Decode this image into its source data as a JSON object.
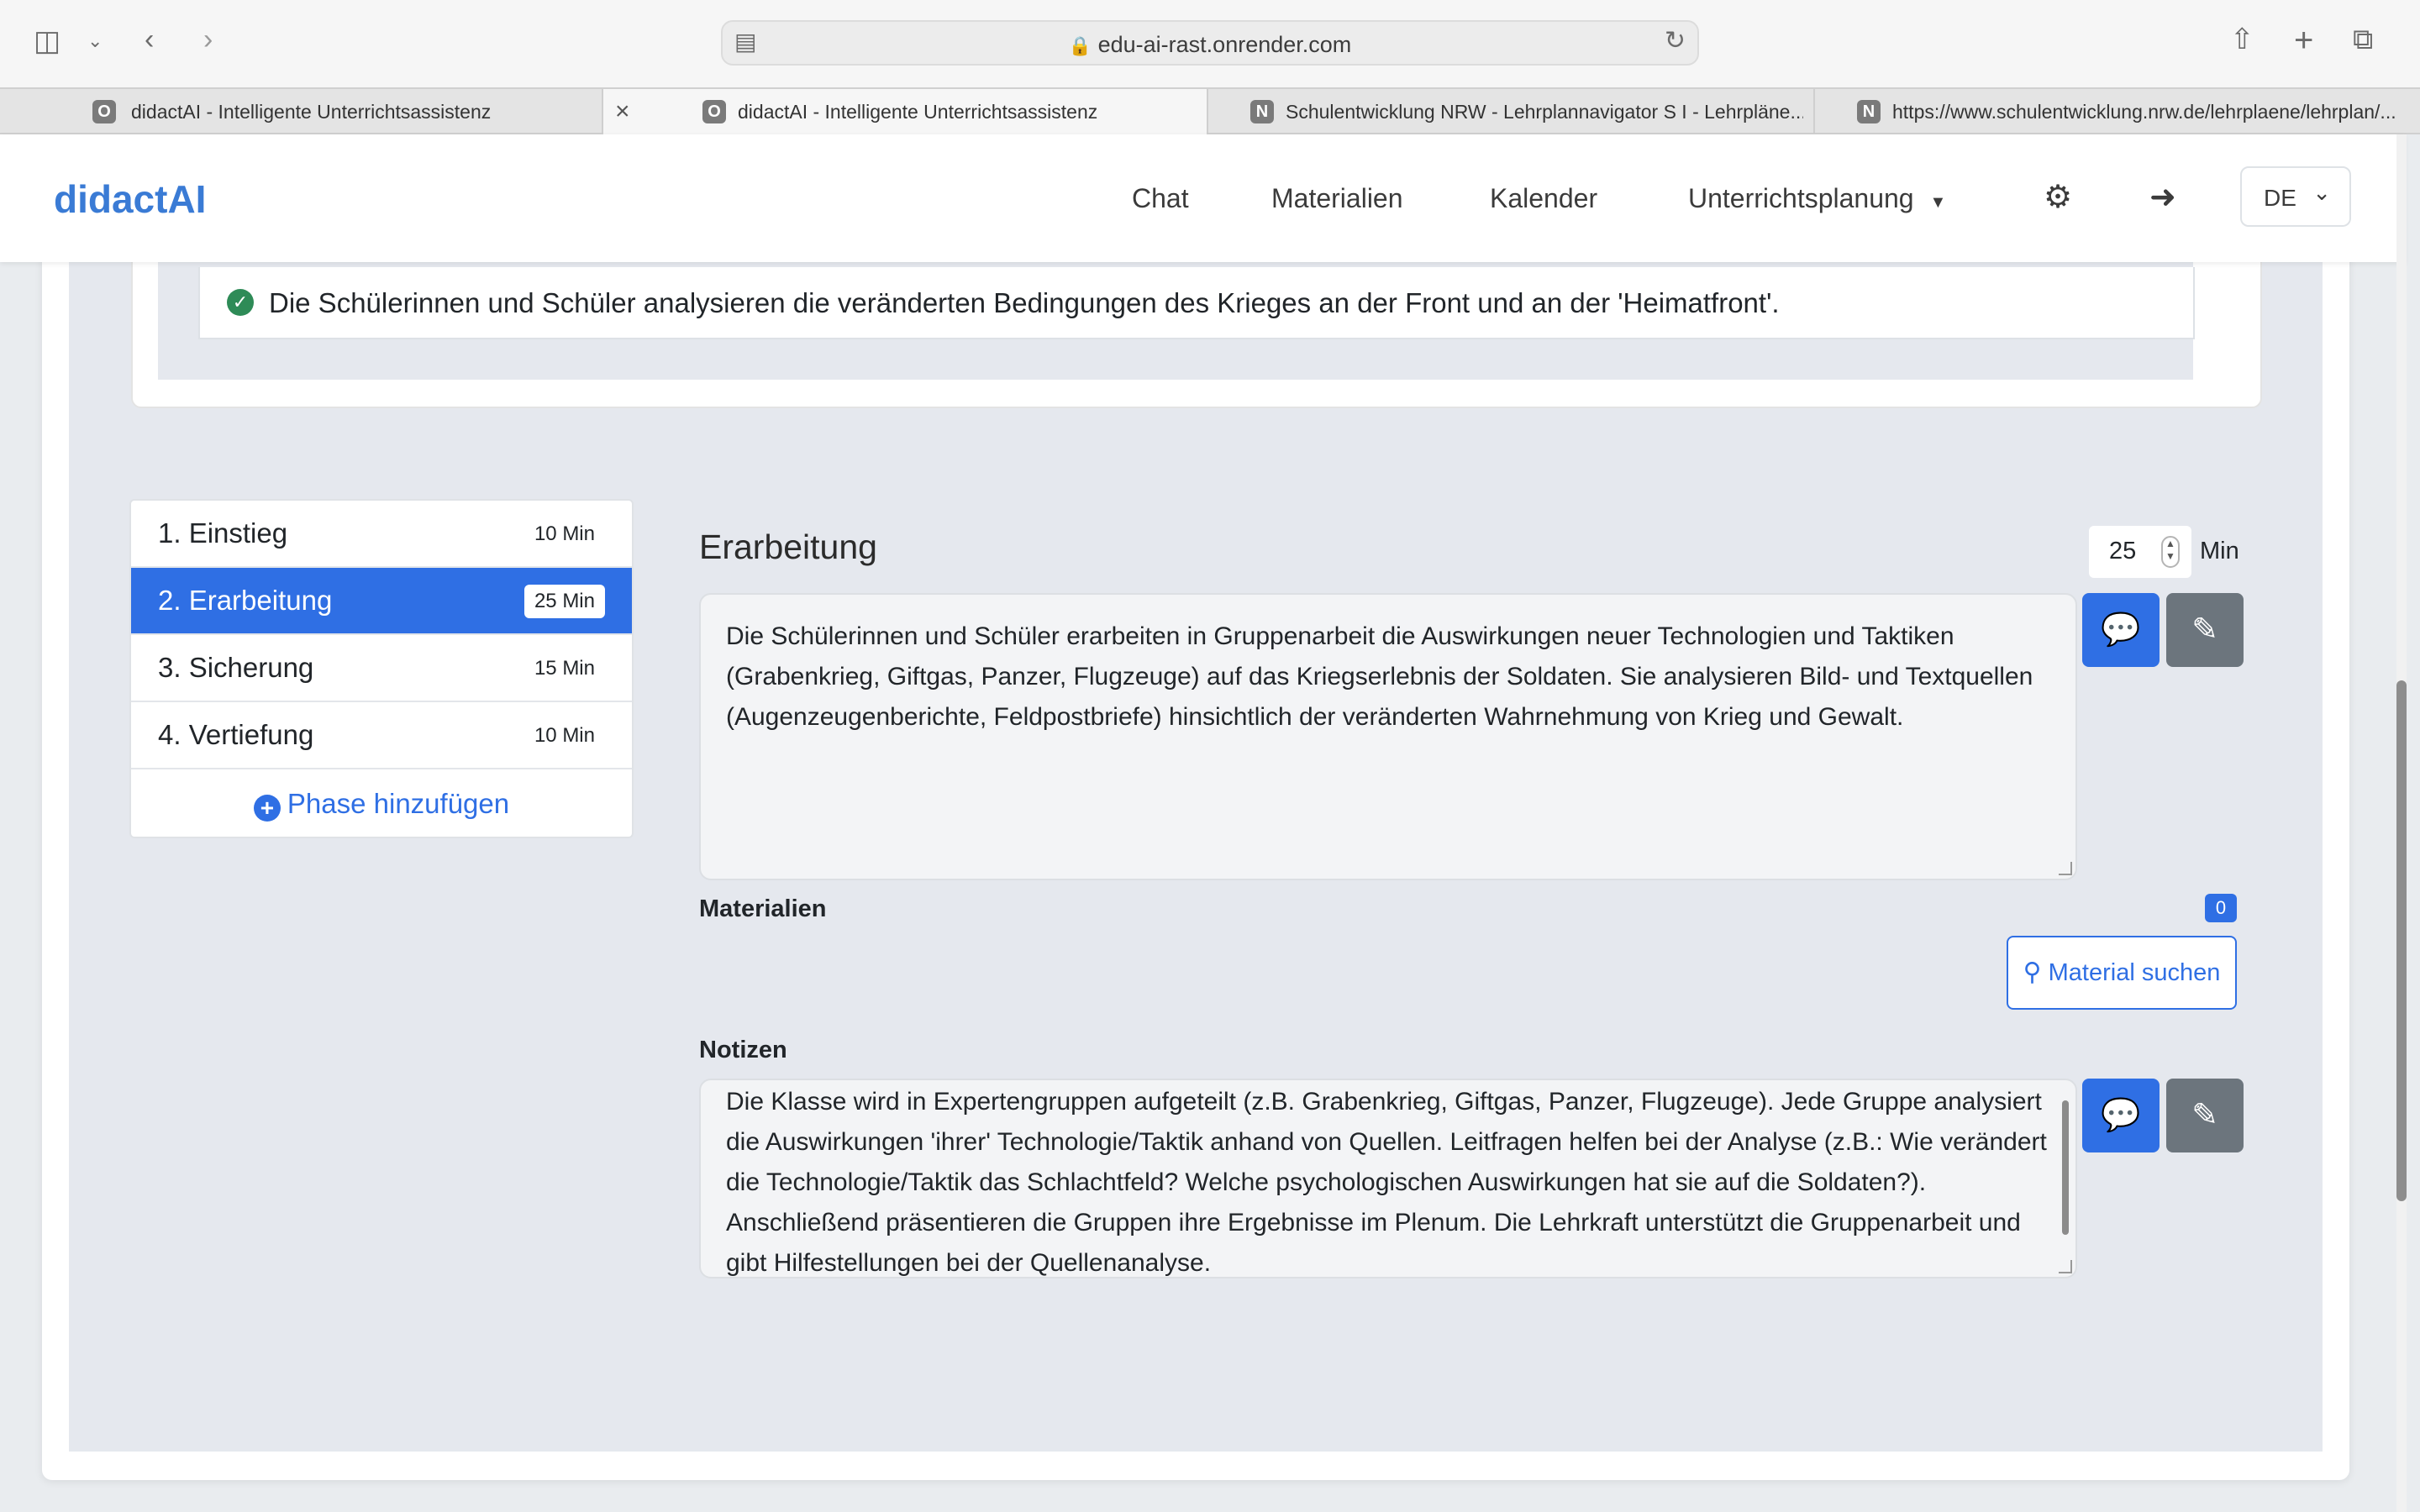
{
  "browser": {
    "url": "edu-ai-rast.onrender.com",
    "tabs": [
      {
        "favicon": "O",
        "label": "didactAI - Intelligente Unterrichtsassistenz",
        "active": false
      },
      {
        "favicon": "O",
        "label": "didactAI - Intelligente Unterrichtsassistenz",
        "active": true
      },
      {
        "favicon": "N",
        "label": "Schulentwicklung NRW - Lehrplannavigator S I - Lehrpläne...",
        "active": false
      },
      {
        "favicon": "N",
        "label": "https://www.schulentwicklung.nrw.de/lehrplaene/lehrplan/...",
        "active": false
      }
    ]
  },
  "navbar": {
    "brand": "didactAI",
    "links": [
      "Chat",
      "Materialien",
      "Kalender",
      "Unterrichtsplanung"
    ],
    "language": "DE"
  },
  "objective": {
    "text": "Die Schülerinnen und Schüler analysieren die veränderten Bedingungen des Krieges an der Front und an der 'Heimatfront'."
  },
  "phases": [
    {
      "label": "1. Einstieg",
      "duration": "10 Min",
      "active": false
    },
    {
      "label": "2. Erarbeitung",
      "duration": "25 Min",
      "active": true
    },
    {
      "label": "3. Sicherung",
      "duration": "15 Min",
      "active": false
    },
    {
      "label": "4. Vertiefung",
      "duration": "10 Min",
      "active": false
    }
  ],
  "add_phase_label": "Phase hinzufügen",
  "detail": {
    "title": "Erarbeitung",
    "minutes": "25",
    "minutes_unit": "Min",
    "description": "Die Schülerinnen und Schüler erarbeiten in Gruppenarbeit die Auswirkungen neuer Technologien und Taktiken (Grabenkrieg, Giftgas, Panzer, Flugzeuge) auf das Kriegserlebnis der Soldaten. Sie analysieren Bild- und Textquellen (Augenzeugenberichte, Feldpostbriefe) hinsichtlich der veränderten Wahrnehmung von Krieg und Gewalt.",
    "materials_label": "Materialien",
    "materials_count": "0",
    "material_search_label": "Material suchen",
    "notes_label": "Notizen",
    "notes": "Die Klasse wird in Expertengruppen aufgeteilt (z.B. Grabenkrieg, Giftgas, Panzer, Flugzeuge). Jede Gruppe analysiert die Auswirkungen 'ihrer' Technologie/Taktik anhand von Quellen. Leitfragen helfen bei der Analyse (z.B.: Wie verändert die Technologie/Taktik das Schlachtfeld? Welche psychologischen Auswirkungen hat sie auf die Soldaten?). Anschließend präsentieren die Gruppen ihre Ergebnisse im Plenum. Die Lehrkraft unterstützt die Gruppenarbeit und gibt Hilfestellungen bei der Quellenanalyse."
  },
  "colors": {
    "accent": "#2f6fe4",
    "brand": "#3a7bd5",
    "success": "#2e8b57",
    "secondary": "#6c757d"
  }
}
